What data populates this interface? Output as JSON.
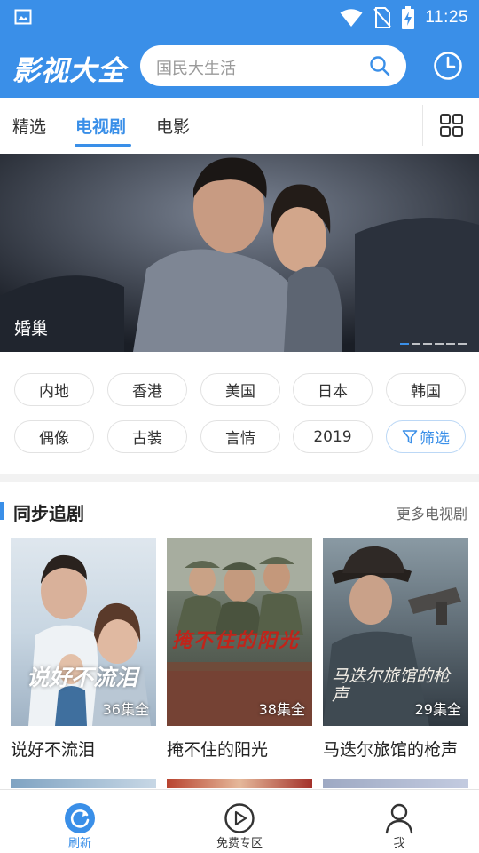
{
  "status_bar": {
    "time": "11:25",
    "icons": [
      "image-icon",
      "wifi-icon",
      "no-sim-icon",
      "battery-charging-icon"
    ]
  },
  "header": {
    "title": "影视大全",
    "search_placeholder": "国民大生活",
    "history_icon": "history-icon"
  },
  "tabs": [
    {
      "label": "精选",
      "active": false
    },
    {
      "label": "电视剧",
      "active": true
    },
    {
      "label": "电影",
      "active": false
    }
  ],
  "banner": {
    "caption": "婚巢",
    "page_count": 6,
    "current_page": 1
  },
  "filters": {
    "row1": [
      "内地",
      "香港",
      "美国",
      "日本",
      "韩国"
    ],
    "row2": [
      "偶像",
      "古装",
      "言情",
      "2019"
    ],
    "filter_label": "筛选"
  },
  "section": {
    "title": "同步追剧",
    "more": "更多电视剧",
    "items": [
      {
        "title": "说好不流泪",
        "episodes": "36集全",
        "poster_text": "说好不流泪"
      },
      {
        "title": "掩不住的阳光",
        "episodes": "38集全",
        "poster_text": "掩不住的阳光"
      },
      {
        "title": "马迭尔旅馆的枪声",
        "episodes": "29集全",
        "poster_text": "马迭尔旅馆的枪声"
      }
    ]
  },
  "bottom_nav": [
    {
      "label": "刷新",
      "icon": "refresh-icon",
      "active": true
    },
    {
      "label": "免费专区",
      "icon": "play-circle-icon",
      "active": false
    },
    {
      "label": "我",
      "icon": "user-icon",
      "active": false
    }
  ],
  "colors": {
    "accent": "#3a8fe8",
    "text": "#222222",
    "muted": "#9a9a9a"
  }
}
